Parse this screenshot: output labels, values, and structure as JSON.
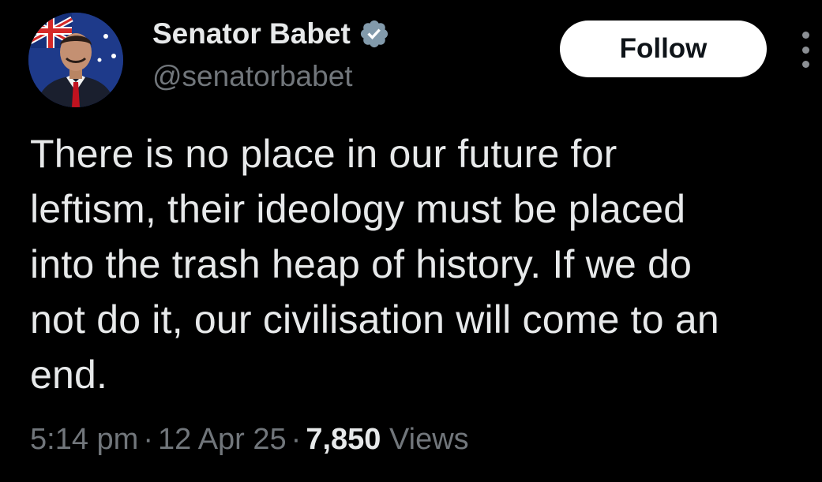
{
  "author": {
    "display_name": "Senator Babet",
    "handle": "@senatorbabet",
    "verified": true
  },
  "follow_button": {
    "label": "Follow"
  },
  "more_button": {
    "icon": "more-vertical-icon"
  },
  "tweet": {
    "text": "There is no place in our future for\nleftism, their ideology must be placed\ninto the trash heap of history. If we do\nnot do it, our civilisation will come to an\nend."
  },
  "meta": {
    "time": "5:14 pm",
    "separator": "·",
    "date": "12 Apr 25",
    "views_count": "7,850",
    "views_label": "Views"
  },
  "colors": {
    "background": "#000000",
    "text_primary": "#e7e9ea",
    "text_secondary": "#71767b",
    "verified_badge": "#829aab",
    "follow_button_bg": "#ffffff",
    "follow_button_text": "#0f1419"
  }
}
